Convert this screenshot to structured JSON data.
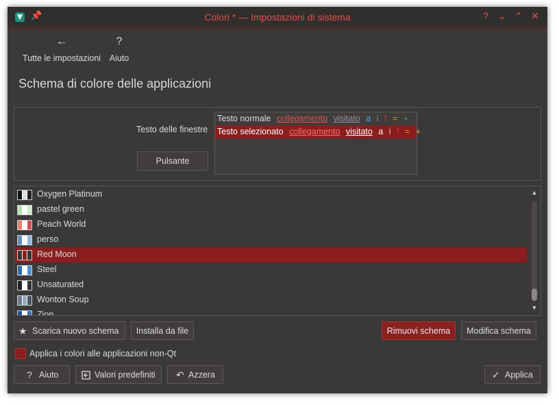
{
  "window": {
    "title": "Colori * — Impostazioni di sistema",
    "controls": {
      "help": "?",
      "minimize": "⌄",
      "maximize": "⌃",
      "close": "✕"
    }
  },
  "nav": {
    "back": {
      "icon": "arrow-left-icon",
      "glyph": "←",
      "label": "Tutte le impostazioni"
    },
    "help": {
      "icon": "help-icon",
      "glyph": "?",
      "label": "Aiuto"
    }
  },
  "page_title": "Schema di colore delle applicazioni",
  "preview": {
    "window_label": "Testo delle finestre",
    "button_label": "Pulsante",
    "normal_row": {
      "text": "Testo normale",
      "link": "collegamento",
      "visited": "visitato",
      "active": "a",
      "inactive": "i",
      "negative": "!",
      "neutral": "=",
      "positive": "+"
    },
    "selected_row": {
      "text": "Testo selezionato",
      "link": "collegamento",
      "visited": "visitato",
      "active": "a",
      "inactive": "i",
      "negative": "!",
      "neutral": "=",
      "positive": "+"
    }
  },
  "schemes": [
    {
      "name": "Oxygen Platinum",
      "selected": false,
      "swatch": [
        "#111111",
        "#dddddd",
        "#222222"
      ]
    },
    {
      "name": "pastel green",
      "selected": false,
      "swatch": [
        "#b8e0b0",
        "#ffffff",
        "#cfe8c8"
      ]
    },
    {
      "name": "Peach World",
      "selected": false,
      "swatch": [
        "#e88070",
        "#ffffff",
        "#d05050"
      ]
    },
    {
      "name": "perso",
      "selected": false,
      "swatch": [
        "#6090c0",
        "#ffffff",
        "#90b8e0"
      ]
    },
    {
      "name": "Red Moon",
      "selected": true,
      "swatch": [
        "#3a3434",
        "#8a2020",
        "#3a3434"
      ]
    },
    {
      "name": "Steel",
      "selected": false,
      "swatch": [
        "#3070b0",
        "#ffffff",
        "#5090d0"
      ]
    },
    {
      "name": "Unsaturated",
      "selected": false,
      "swatch": [
        "#222222",
        "#ffffff",
        "#333333"
      ]
    },
    {
      "name": "Wonton Soup",
      "selected": false,
      "swatch": [
        "#6c7a8c",
        "#9aa8b8",
        "#4a5868"
      ]
    },
    {
      "name": "Zion",
      "selected": false,
      "swatch": [
        "#2050a0",
        "#ffffff",
        "#4070c0"
      ]
    }
  ],
  "actions": {
    "download": {
      "icon": "star-icon",
      "label": "Scarica nuovo schema"
    },
    "install": "Installa da file",
    "remove": "Rimuovi schema",
    "edit": "Modifica schema"
  },
  "apply_non_qt": {
    "label": "Applica i colori alle applicazioni non-Qt",
    "checked": true
  },
  "footer": {
    "help": {
      "icon": "help-icon",
      "label": "Aiuto"
    },
    "defaults": {
      "icon": "restore-defaults-icon",
      "label": "Valori predefiniti"
    },
    "reset": {
      "icon": "undo-icon",
      "label": "Azzera"
    },
    "apply": {
      "icon": "checkmark-icon",
      "label": "Applica"
    }
  },
  "colors": {
    "accent": "#e0504c",
    "selection": "#8a1e1e",
    "background": "#3b3838"
  }
}
